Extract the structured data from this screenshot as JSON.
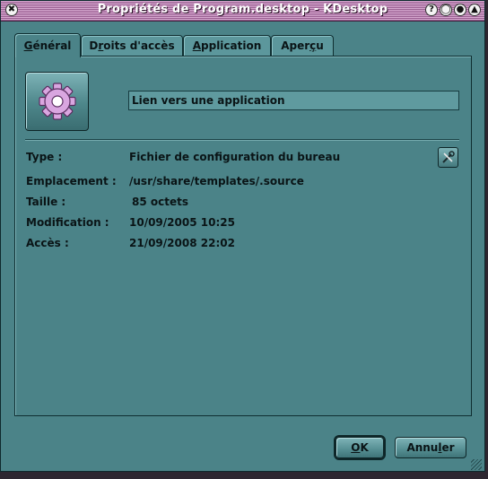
{
  "window": {
    "title": "Propriétés de Program.desktop - KDesktop",
    "title_buttons": [
      {
        "name": "window-menu",
        "glyph": "✖"
      },
      {
        "name": "help",
        "glyph": "?"
      },
      {
        "name": "maximize",
        "glyph": "◯"
      },
      {
        "name": "minimize",
        "glyph": "●"
      },
      {
        "name": "close",
        "glyph": "▲"
      }
    ]
  },
  "tabs": [
    {
      "pre": "",
      "mn": "G",
      "post": "énéral",
      "active": true
    },
    {
      "pre": "D",
      "mn": "r",
      "post": "oits d'accès",
      "active": false
    },
    {
      "pre": "",
      "mn": "A",
      "post": "pplication",
      "active": false
    },
    {
      "pre": "Aper",
      "mn": "ç",
      "post": "u",
      "active": false
    }
  ],
  "general": {
    "icon": "gear-icon",
    "name_value": "Lien vers une application",
    "rows": [
      {
        "label": "Type :",
        "value": "Fichier de configuration du bureau"
      },
      {
        "label": "Emplacement :",
        "value": "/usr/share/templates/.source"
      },
      {
        "label": "Taille :",
        "value": "85 octets"
      },
      {
        "label": "Modification :",
        "value": "10/09/2005 10:25"
      },
      {
        "label": "Accès :",
        "value": "21/09/2008 22:02"
      }
    ]
  },
  "buttons": {
    "ok_mn": "O",
    "ok_rest": "K",
    "cancel_pre": "Annu",
    "cancel_mn": "l",
    "cancel_post": "er"
  },
  "colors": {
    "window_bg": "#4b8388",
    "titlebar": "#9a5f92",
    "gear": "#d9a6e0"
  }
}
